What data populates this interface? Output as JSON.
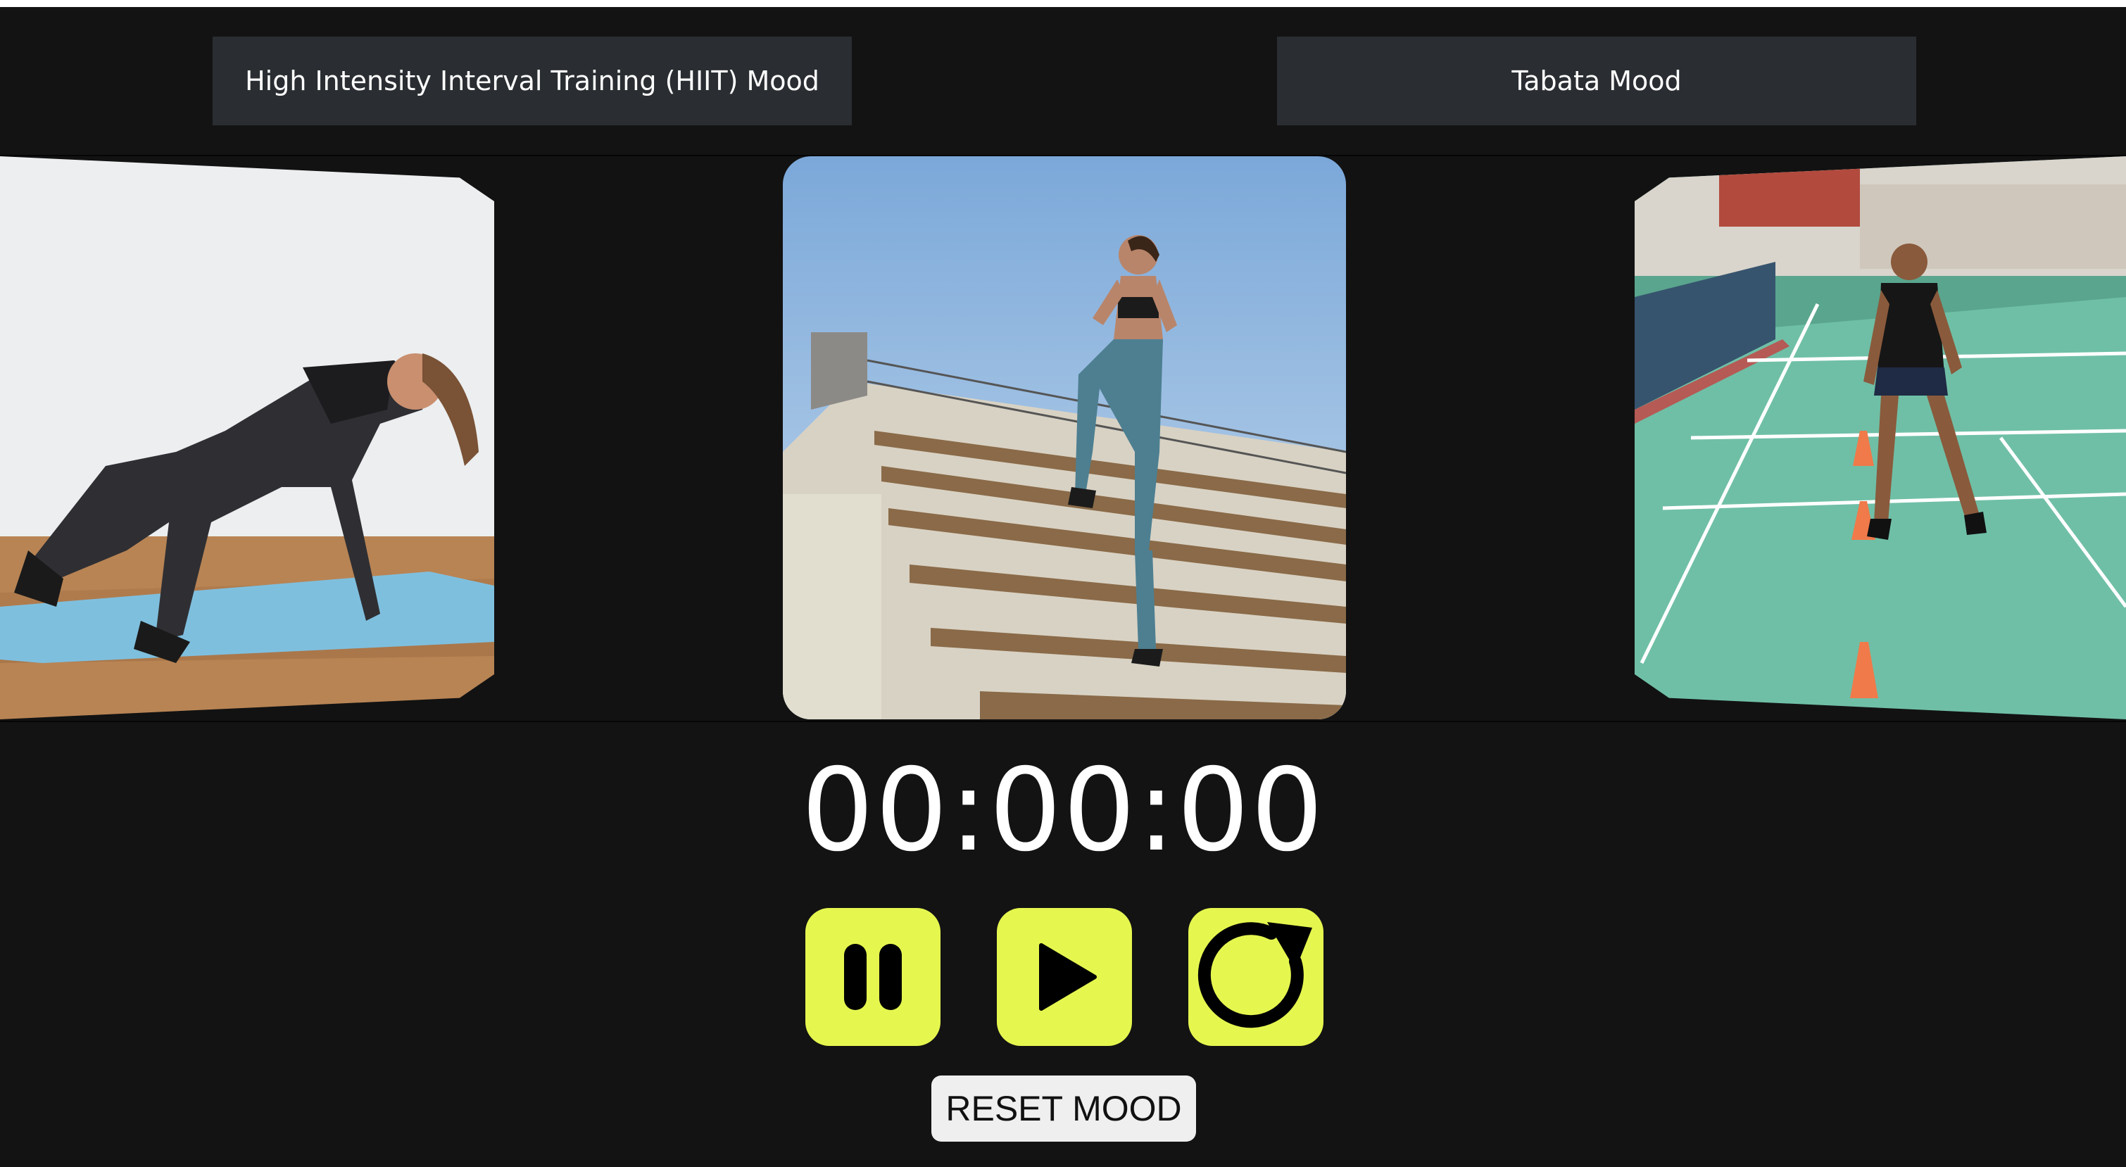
{
  "moods": {
    "hiit_label": "High Intensity Interval Training (HIIT) Mood",
    "tabata_label": "Tabata Mood"
  },
  "carousel": {
    "cards": [
      {
        "name": "mountain-climber-image"
      },
      {
        "name": "stadium-stairs-jump-image"
      },
      {
        "name": "court-agility-drill-image"
      }
    ]
  },
  "timer": {
    "display": "00:00:00"
  },
  "controls": {
    "pause_icon": "pause-icon",
    "play_icon": "play-icon",
    "restart_icon": "restart-icon",
    "accent_color": "#e5f74f"
  },
  "reset": {
    "label": "RESET MOOD"
  }
}
